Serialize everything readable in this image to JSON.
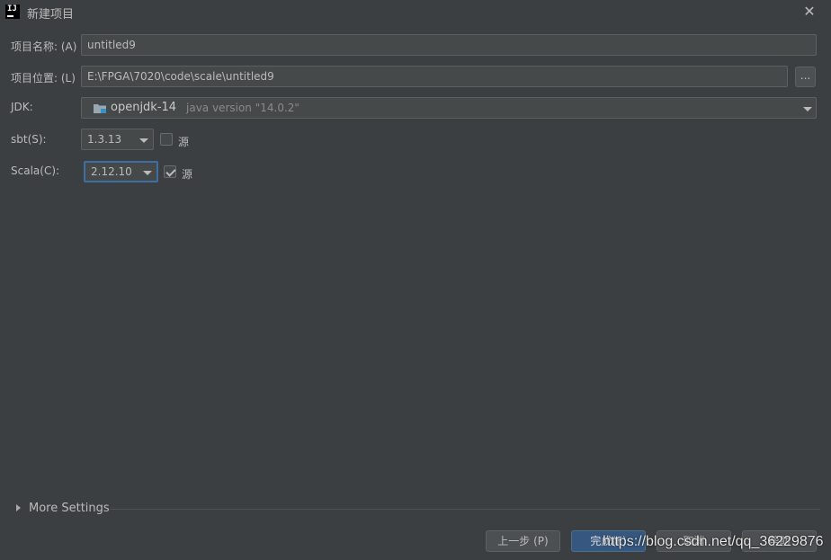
{
  "window": {
    "title": "新建项目",
    "app_icon_text": "IJ",
    "close_icon": "close-icon"
  },
  "form": {
    "name_label": "项目名称: (A)",
    "name_value": "untitled9",
    "location_label": "项目位置: (L)",
    "location_value": "E:\\FPGA\\7020\\code\\scale\\untitled9",
    "browse_label": "...",
    "jdk_label": "JDK:",
    "jdk_name": "openjdk-14",
    "jdk_version": "java version \"14.0.2\"",
    "sbt_label": "sbt(S):",
    "sbt_value": "1.3.13",
    "sbt_sources_label": "源",
    "sbt_sources_checked": false,
    "scala_label": "Scala(C):",
    "scala_value": "2.12.10",
    "scala_sources_label": "源",
    "scala_sources_checked": true
  },
  "more_settings": {
    "label": "More Settings"
  },
  "buttons": {
    "previous": "上一步 (P)",
    "finish": "完成(F)",
    "cancel": "取消",
    "help": "帮助"
  },
  "watermark": "https://blog.csdn.net/qq_36229876",
  "colors": {
    "background": "#3c3f41",
    "accent": "#365880",
    "focus": "#3d6fa3"
  }
}
